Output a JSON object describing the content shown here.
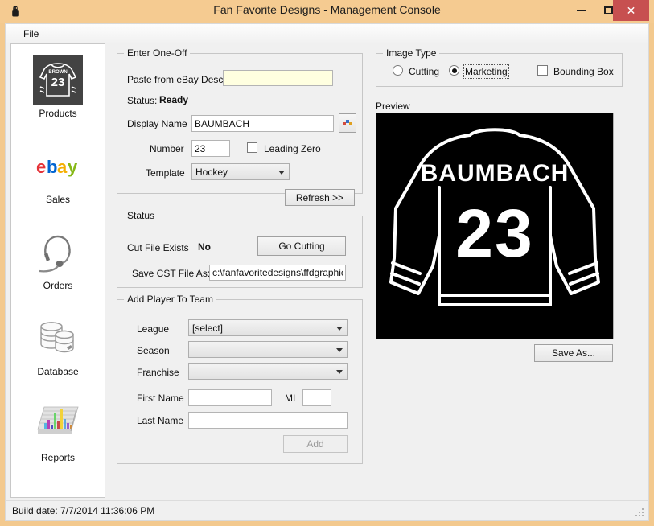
{
  "window": {
    "title": "Fan Favorite Designs - Management Console",
    "app_icon": "app-icon",
    "minimize_label": "–",
    "maximize_label": "□",
    "close_label": "✕"
  },
  "menu": {
    "file_label": "File"
  },
  "sidebar": {
    "items": [
      {
        "label": "Products",
        "icon": "jersey-icon"
      },
      {
        "label": "Sales",
        "icon": "ebay-logo-icon"
      },
      {
        "label": "Orders",
        "icon": "headset-icon"
      },
      {
        "label": "Database",
        "icon": "database-cylinders-icon"
      },
      {
        "label": "Reports",
        "icon": "bar-chart-3d-icon"
      }
    ]
  },
  "enter_one_off": {
    "title": "Enter One-Off",
    "paste_label": "Paste from eBay Desc",
    "paste_value": "",
    "paste_placeholder": "",
    "status_label": "Status:",
    "status_value": "Ready",
    "display_name_label": "Display Name",
    "display_name_value": "BAUMBACH",
    "expand_button_icon": "color-swatch-icon",
    "number_label": "Number",
    "number_value": "23",
    "leading_zero_label": "Leading Zero",
    "leading_zero_checked": false,
    "template_label": "Template",
    "template_value": "Hockey",
    "template_options": [
      "Hockey"
    ],
    "refresh_label": "Refresh >>"
  },
  "status_group": {
    "title": "Status",
    "cut_file_exists_label": "Cut File Exists",
    "cut_file_exists_value": "No",
    "go_cutting_label": "Go Cutting",
    "save_cst_label": "Save CST File As:",
    "save_cst_value": "c:\\fanfavoritedesigns\\ffdgraphics\\"
  },
  "add_player": {
    "title": "Add Player To Team",
    "league_label": "League",
    "league_value": "[select]",
    "season_label": "Season",
    "season_value": "",
    "franchise_label": "Franchise",
    "franchise_value": "",
    "first_name_label": "First Name",
    "first_name_value": "",
    "mi_label": "MI",
    "mi_value": "",
    "last_name_label": "Last Name",
    "last_name_value": "",
    "add_label": "Add"
  },
  "image_type": {
    "title": "Image Type",
    "cutting_label": "Cutting",
    "cutting_selected": false,
    "marketing_label": "Marketing",
    "marketing_selected": true,
    "bounding_box_label": "Bounding Box",
    "bounding_box_checked": false
  },
  "preview": {
    "label": "Preview",
    "jersey_name": "BAUMBACH",
    "jersey_number": "23",
    "save_as_label": "Save As...",
    "background_color": "#000000",
    "stroke_color": "#ffffff"
  },
  "statusbar": {
    "build_text": "Build date: 7/7/2014 11:36:06 PM"
  },
  "colors": {
    "titlebar": "#f5cb91",
    "close_button": "#c75050",
    "client": "#f0f0f0",
    "paste_field": "#ffffe0"
  }
}
